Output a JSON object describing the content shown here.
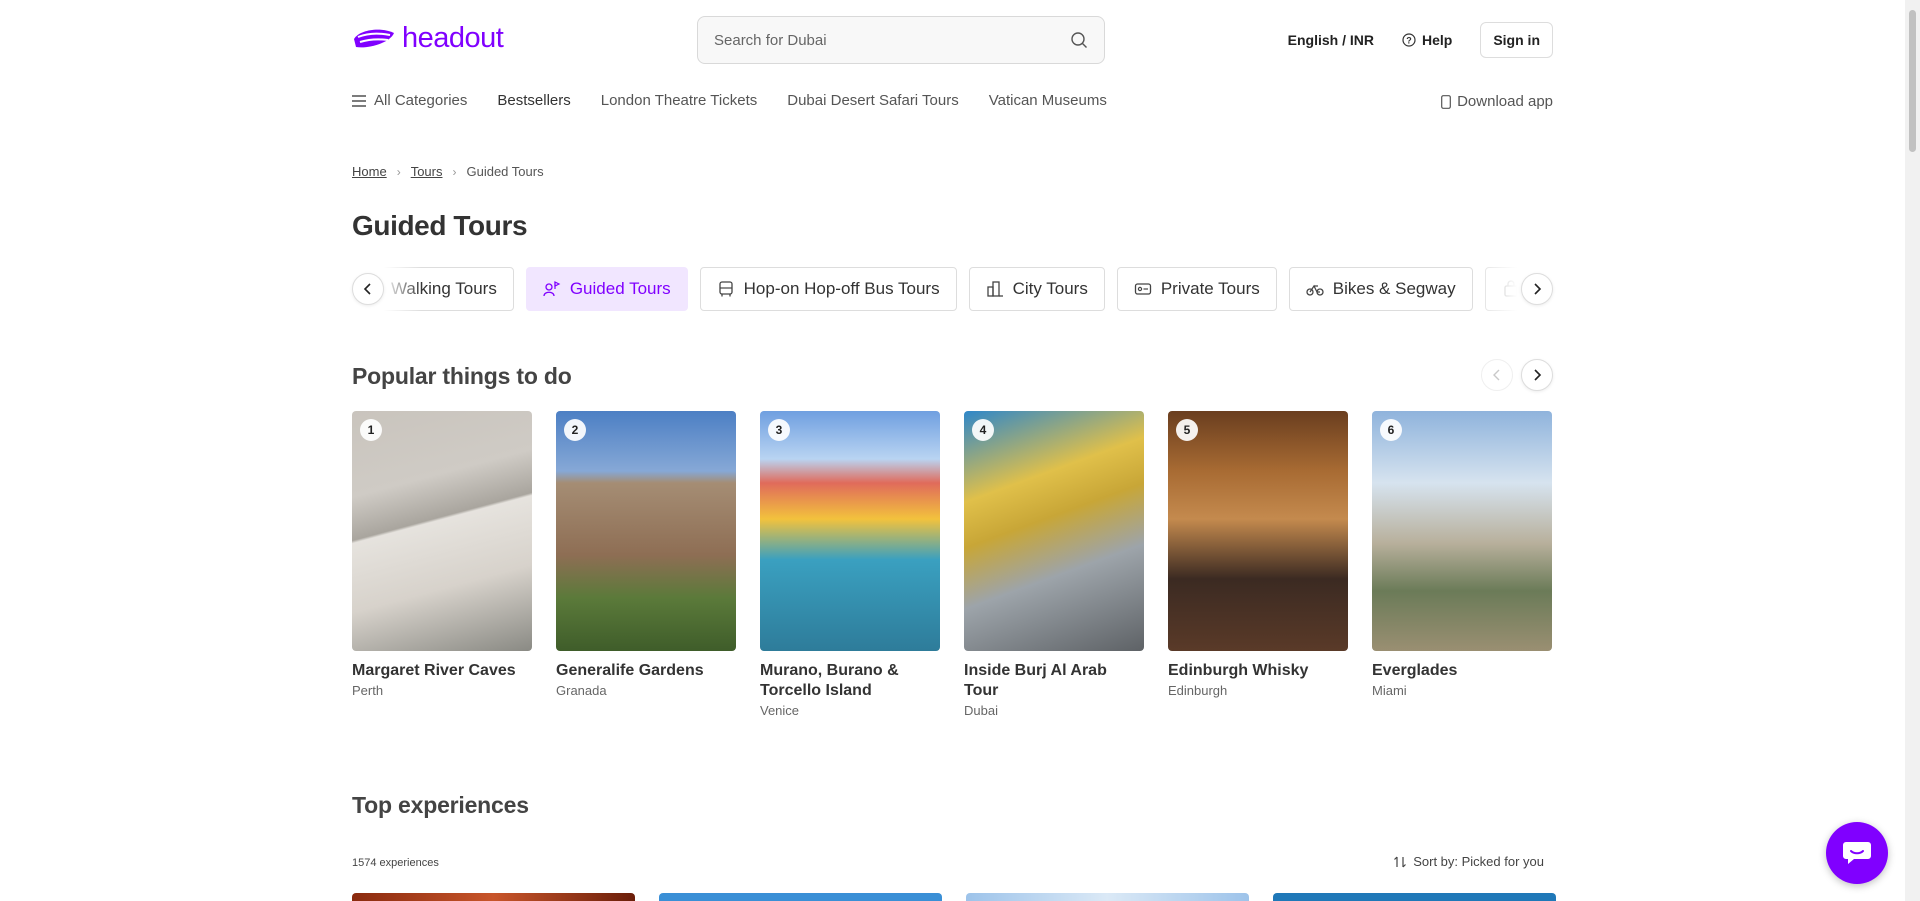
{
  "header": {
    "logo_text": "headout",
    "search_placeholder": "Search for Dubai",
    "language": "English / INR",
    "help": "Help",
    "sign_in": "Sign in"
  },
  "nav": {
    "all_categories": "All Categories",
    "items": [
      "Bestsellers",
      "London Theatre Tickets",
      "Dubai Desert Safari Tours",
      "Vatican Museums"
    ],
    "download_app": "Download app"
  },
  "breadcrumb": [
    "Home",
    "Tours",
    "Guided Tours"
  ],
  "page_title": "Guided Tours",
  "categories": [
    {
      "label": "Walking Tours",
      "icon": "walking-icon",
      "active": false
    },
    {
      "label": "Guided Tours",
      "icon": "guide-icon",
      "active": true
    },
    {
      "label": "Hop-on Hop-off Bus Tours",
      "icon": "bus-icon",
      "active": false
    },
    {
      "label": "City Tours",
      "icon": "city-icon",
      "active": false
    },
    {
      "label": "Private Tours",
      "icon": "private-tour-icon",
      "active": false
    },
    {
      "label": "Bikes & Segway",
      "icon": "bike-icon",
      "active": false
    }
  ],
  "popular": {
    "title": "Popular things to do",
    "items": [
      {
        "rank": "1",
        "title": "Margaret River Caves",
        "city": "Perth"
      },
      {
        "rank": "2",
        "title": "Generalife Gardens",
        "city": "Granada"
      },
      {
        "rank": "3",
        "title": "Murano, Burano & Torcello Island",
        "city": "Venice"
      },
      {
        "rank": "4",
        "title": "Inside Burj Al Arab Tour",
        "city": "Dubai"
      },
      {
        "rank": "5",
        "title": "Edinburgh Whisky",
        "city": "Edinburgh"
      },
      {
        "rank": "6",
        "title": "Everglades",
        "city": "Miami"
      }
    ]
  },
  "top_experiences": {
    "title": "Top experiences",
    "count": "1574 experiences",
    "sort": "Sort by: Picked for you"
  },
  "colors": {
    "brand": "#8000ff",
    "active_chip_bg": "#f1e6ff"
  }
}
